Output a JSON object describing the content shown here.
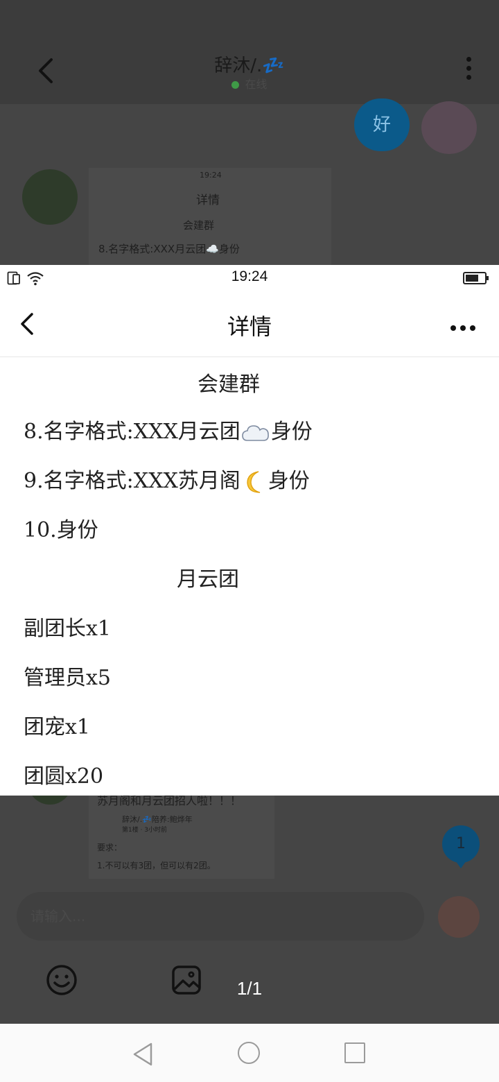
{
  "background_chat": {
    "title": "辞沐/.💤",
    "status": "在线",
    "reply_bubble": "好",
    "card1": {
      "time": "19:24",
      "title": "详情",
      "heading": "会建群",
      "line": "8.名字格式:XXX月云团☁️身份"
    },
    "card2": {
      "headline": "苏月阁和月云团招人啦！！！",
      "author": "辞沐/.💤陪养:鲍烨年",
      "meta": "第1楼 · 3小时前",
      "body1": "要求：",
      "body2": "1.不可以有3团，但可以有2团。"
    },
    "unread_count": "1",
    "input_placeholder": "请输入..."
  },
  "preview": {
    "status_bar": {
      "time": "19:24"
    },
    "nav": {
      "title": "详情"
    },
    "lines": {
      "heading1": "会建群",
      "l8_prefix": "8.名字格式:XXX月云团",
      "l8_suffix": "身份",
      "l9_prefix": "9.名字格式:XXX苏月阁",
      "l9_suffix": "身份",
      "l10": "10.身份",
      "heading2": "月云团",
      "r1": "副团长x1",
      "r2": "管理员x5",
      "r3": "团宠x1",
      "r4": "团圆x20"
    }
  },
  "viewer": {
    "page_counter": "1/1"
  },
  "icons": {
    "cloud": "cloud-icon",
    "moon": "crescent-moon-icon",
    "back": "chevron-left-icon",
    "more": "more-dots-icon"
  }
}
